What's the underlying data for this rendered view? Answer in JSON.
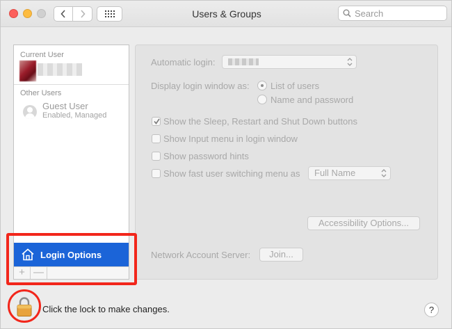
{
  "window": {
    "title": "Users & Groups"
  },
  "search": {
    "placeholder": "Search"
  },
  "sidebar": {
    "current_user_label": "Current User",
    "other_users_label": "Other Users",
    "guest_name": "Guest User",
    "guest_status": "Enabled, Managed",
    "login_options_label": "Login Options",
    "add_label": "+",
    "remove_label": "—"
  },
  "panel": {
    "automatic_login_label": "Automatic login:",
    "display_login_label": "Display login window as:",
    "radio_list_label": "List of users",
    "radio_name_label": "Name and password",
    "radio_selected": "List of users",
    "checkboxes": [
      {
        "label": "Show the Sleep, Restart and Shut Down buttons",
        "checked": true
      },
      {
        "label": "Show Input menu in login window",
        "checked": false
      },
      {
        "label": "Show password hints",
        "checked": false
      },
      {
        "label": "Show fast user switching menu as",
        "checked": false
      }
    ],
    "fast_switch_value": "Full Name",
    "accessibility_button": "Accessibility Options...",
    "network_label": "Network Account Server:",
    "join_button": "Join..."
  },
  "footer": {
    "lock_text": "Click the lock to make changes.",
    "help_label": "?"
  },
  "colors": {
    "selection": "#1b64d8",
    "highlight": "#f2261b",
    "lock": "#e8a33d"
  },
  "icons": [
    "back-icon",
    "forward-icon",
    "grid-icon",
    "search-icon",
    "house-icon",
    "user-silhouette-icon",
    "lock-icon",
    "checkmark-icon",
    "popup-arrows-icon"
  ]
}
